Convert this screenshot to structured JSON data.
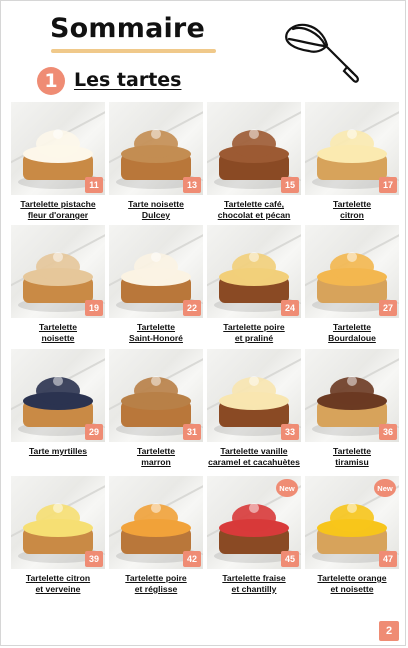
{
  "header": {
    "title": "Sommaire"
  },
  "section": {
    "number": "1",
    "title": "Les tartes"
  },
  "items": [
    {
      "lines": [
        "Tartelette pistache",
        "fleur d'oranger"
      ],
      "number": "11",
      "is_new": false
    },
    {
      "lines": [
        "Tarte noisette",
        "Dulcey"
      ],
      "number": "13",
      "is_new": false
    },
    {
      "lines": [
        "Tartelette café,",
        "chocolat et pécan"
      ],
      "number": "15",
      "is_new": false
    },
    {
      "lines": [
        "Tartelette",
        "citron"
      ],
      "number": "17",
      "is_new": false
    },
    {
      "lines": [
        "Tartelette",
        "noisette"
      ],
      "number": "19",
      "is_new": false
    },
    {
      "lines": [
        "Tartelette",
        "Saint-Honoré"
      ],
      "number": "22",
      "is_new": false
    },
    {
      "lines": [
        "Tartelette poire",
        "et praliné"
      ],
      "number": "24",
      "is_new": false
    },
    {
      "lines": [
        "Tartelette",
        "Bourdaloue"
      ],
      "number": "27",
      "is_new": false
    },
    {
      "lines": [
        "Tarte myrtilles"
      ],
      "number": "29",
      "is_new": false
    },
    {
      "lines": [
        "Tartelette",
        "marron"
      ],
      "number": "31",
      "is_new": false
    },
    {
      "lines": [
        "Tartelette vanille",
        "caramel et cacahuètes"
      ],
      "number": "33",
      "is_new": false
    },
    {
      "lines": [
        "Tartelette",
        "tiramisu"
      ],
      "number": "36",
      "is_new": false
    },
    {
      "lines": [
        "Tartelette citron",
        "et verveine"
      ],
      "number": "39",
      "is_new": false
    },
    {
      "lines": [
        "Tartelette poire",
        "et réglisse"
      ],
      "number": "42",
      "is_new": false
    },
    {
      "lines": [
        "Tartelette fraise",
        "et chantilly"
      ],
      "number": "45",
      "is_new": true
    },
    {
      "lines": [
        "Tartelette orange",
        "et noisette"
      ],
      "number": "47",
      "is_new": true
    }
  ],
  "badge_new_label": "New",
  "page_number": "2",
  "colors": {
    "accent": "#ef8c74",
    "underline": "#f0c98a"
  }
}
